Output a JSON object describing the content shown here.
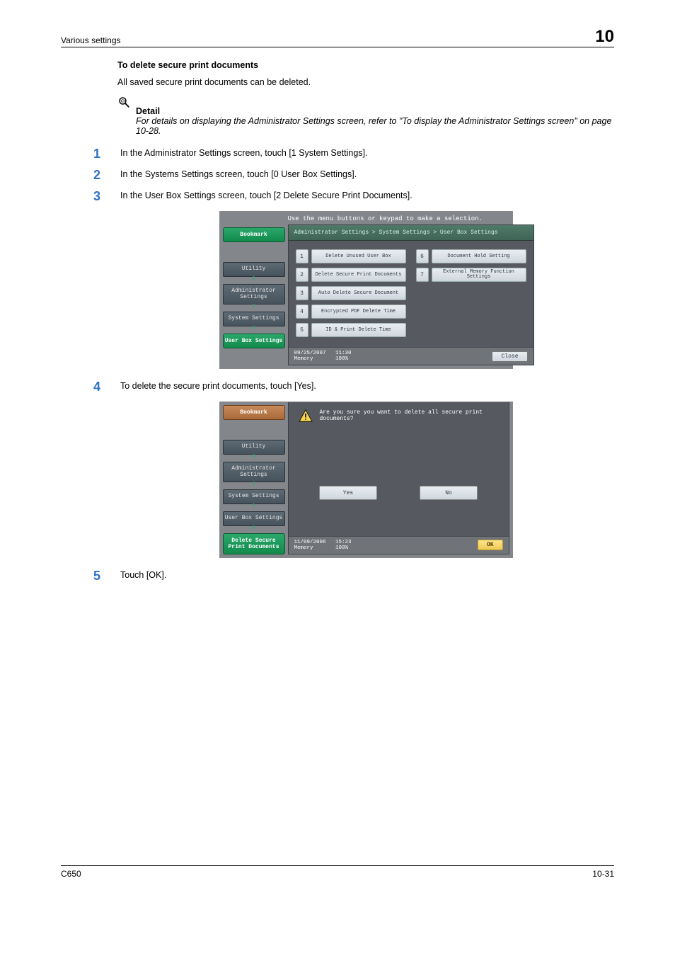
{
  "header": {
    "left": "Various settings",
    "right": "10"
  },
  "section": {
    "title": "To delete secure print documents",
    "intro": "All saved secure print documents can be deleted."
  },
  "detail": {
    "label": "Detail",
    "text": "For details on displaying the Administrator Settings screen, refer to \"To display the Administrator Settings screen\" on page 10-28."
  },
  "steps": {
    "s1": {
      "n": "1",
      "t": "In the Administrator Settings screen, touch [1 System Settings]."
    },
    "s2": {
      "n": "2",
      "t": "In the Systems Settings screen, touch [0 User Box Settings]."
    },
    "s3": {
      "n": "3",
      "t": "In the User Box Settings screen, touch [2 Delete Secure Print Documents]."
    },
    "s4": {
      "n": "4",
      "t": "To delete the secure print documents, touch [Yes]."
    },
    "s5": {
      "n": "5",
      "t": "Touch [OK]."
    }
  },
  "shot1": {
    "inst": "Use the menu buttons or keypad to make a selection.",
    "bc": "Administrator Settings > System Settings > User Box Settings",
    "side": {
      "bookmark": "Bookmark",
      "utility": "Utility",
      "admin": "Administrator Settings",
      "system": "System Settings",
      "userbox": "User Box Settings"
    },
    "menu": {
      "m1n": "1",
      "m1": "Delete Unused User Box",
      "m2n": "2",
      "m2": "Delete Secure Print Documents",
      "m3n": "3",
      "m3": "Auto Delete Secure Document",
      "m4n": "4",
      "m4": "Encrypted PDF Delete Time",
      "m5n": "5",
      "m5": "ID & Print Delete Time",
      "m6n": "6",
      "m6": "Document Hold Setting",
      "m7n": "7",
      "m7": "External Memory Function Settings"
    },
    "status_left": "09/25/2007   11:30\nMemory       100%",
    "close": "Close"
  },
  "shot2": {
    "msg": "Are you sure you want to delete all secure print documents?",
    "side": {
      "bookmark": "Bookmark",
      "utility": "Utility",
      "admin": "Administrator Settings",
      "system": "System Settings",
      "userbox": "User Box Settings",
      "delsec": "Delete Secure Print Documents"
    },
    "yes": "Yes",
    "no": "No",
    "status_left": "11/09/2006   15:23\nMemory       100%",
    "ok": "OK"
  },
  "footer": {
    "left": "C650",
    "right": "10-31"
  }
}
